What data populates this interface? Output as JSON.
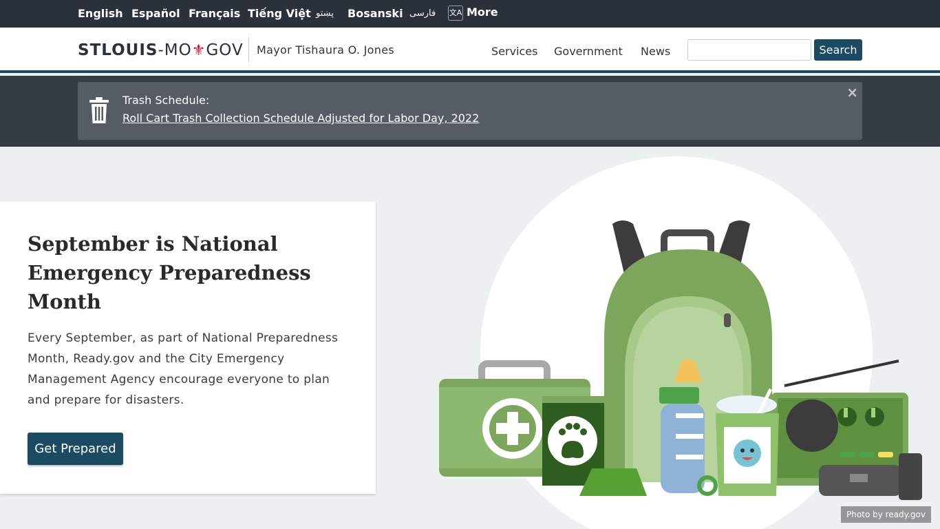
{
  "languages": [
    {
      "label": "English"
    },
    {
      "label": "Español"
    },
    {
      "label": "Français"
    },
    {
      "label": "Tiếng Việt"
    },
    {
      "label": "پښتو"
    },
    {
      "label": "Bosanski"
    },
    {
      "label": "فارسی"
    }
  ],
  "more": {
    "label": "More",
    "icon": "translate-icon",
    "icon_glyph": "文A"
  },
  "header": {
    "logo_bold": "STLOUIS",
    "logo_mid": "-MO",
    "logo_fleur": "⚜",
    "logo_end": "GOV",
    "mayor": "Mayor Tishaura O. Jones",
    "nav": [
      {
        "label": "Services"
      },
      {
        "label": "Government"
      },
      {
        "label": "News"
      }
    ],
    "search": {
      "placeholder": "",
      "button_label": "Search"
    }
  },
  "alert": {
    "icon": "trash-icon",
    "title": "Trash Schedule:",
    "link": "Roll Cart Trash Collection Schedule Adjusted for Labor Day, 2022",
    "close_glyph": "×"
  },
  "hero": {
    "title": "September is National Emergency Preparedness Month",
    "text": "Every September, as part of National Preparedness Month, Ready.gov and the City Emergency Management Agency encourage everyone to plan and prepare for disasters.",
    "button_label": "Get Prepared",
    "photo_credit": "Photo by ready.gov"
  },
  "colors": {
    "topbar": "#2a313b",
    "brand": "#1b4a63",
    "alert_bg": "#565c63",
    "hero_bg": "#ecf0f1",
    "kit_green": "#7ba65c"
  }
}
